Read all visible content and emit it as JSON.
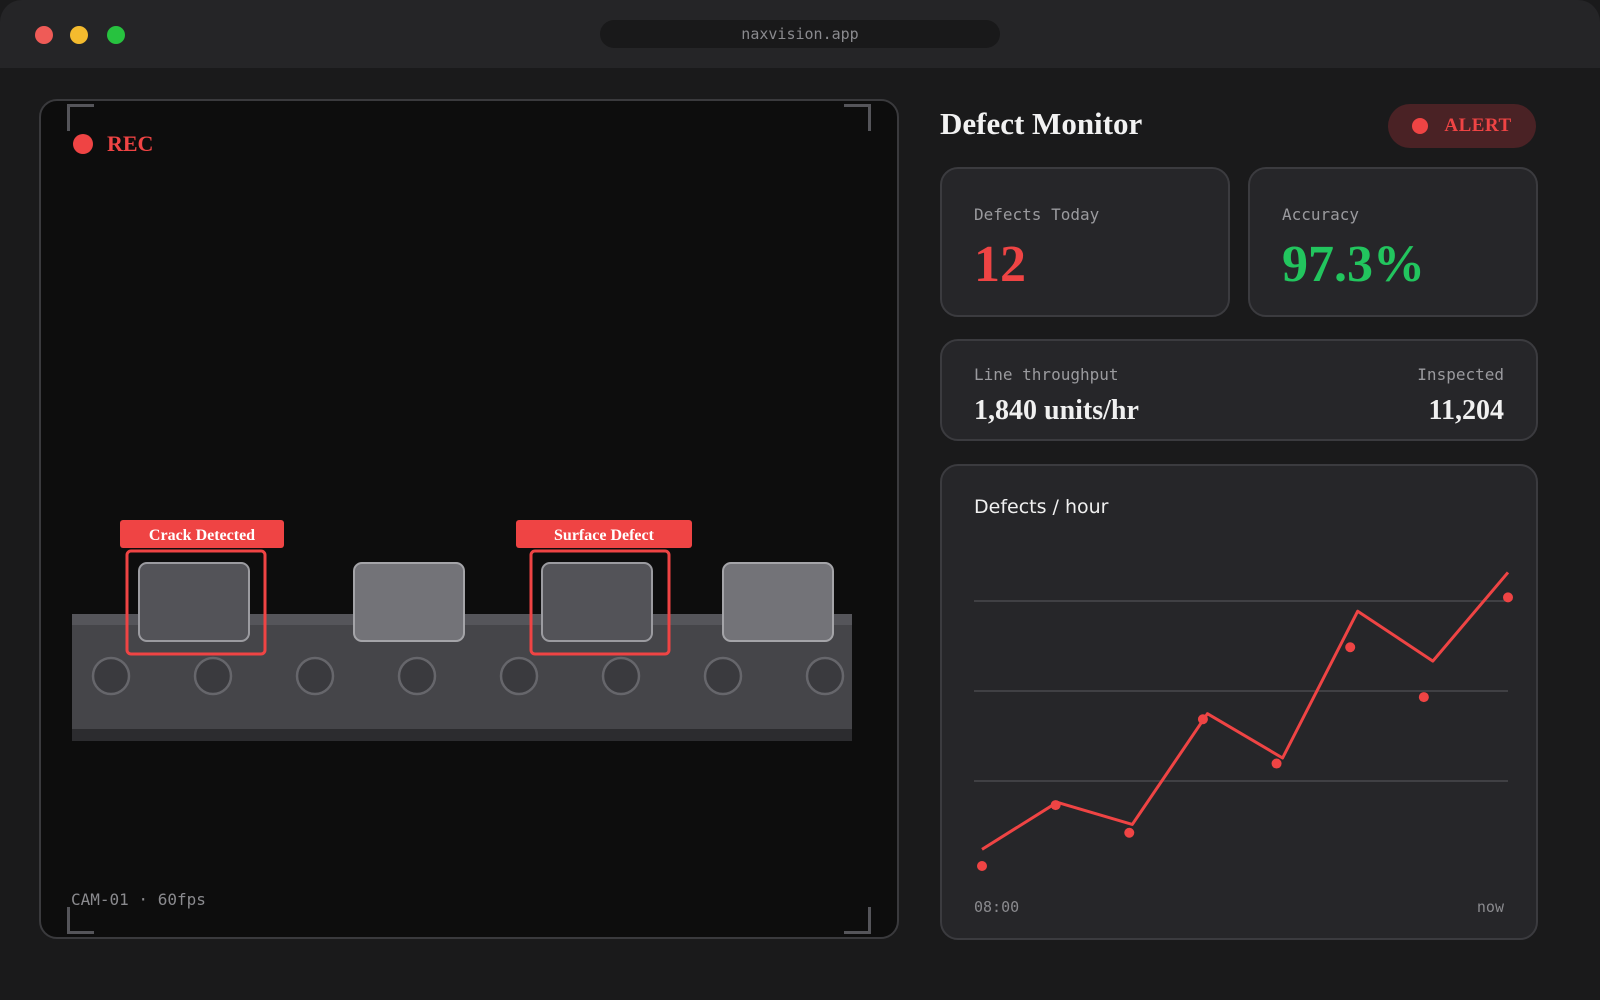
{
  "browser": {
    "url": "naxvision.app"
  },
  "camera": {
    "rec_label": "REC",
    "meta": "CAM-01 · 60fps",
    "detections": [
      {
        "label": "Crack Detected"
      },
      {
        "label": "Surface Defect"
      }
    ]
  },
  "panel": {
    "title": "Defect Monitor",
    "alert_label": "ALERT",
    "stats": {
      "defects_today": {
        "label": "Defects Today",
        "value": "12"
      },
      "accuracy": {
        "label": "Accuracy",
        "value": "97.3%"
      }
    },
    "throughput": {
      "label": "Line throughput",
      "value": "1,840 units/hr",
      "inspected_label": "Inspected",
      "inspected_value": "11,204"
    }
  },
  "colors": {
    "alert": "#ef4444",
    "success": "#22c55e",
    "background": "#1a1a1b",
    "card": "#262629"
  },
  "icons": [
    "rec-indicator-icon",
    "alert-indicator-icon"
  ],
  "chart_data": {
    "type": "line",
    "title": "Defects / hour",
    "x_labels": [
      "08:00",
      "now"
    ],
    "series": [
      {
        "values": [
          1.2,
          4.6,
          3.0,
          11.0,
          7.8,
          18.4,
          14.8,
          21.2
        ]
      }
    ],
    "scatter_points": [
      {
        "x": 0.0,
        "y": 0.0
      },
      {
        "x": 1.4,
        "y": 4.4
      },
      {
        "x": 2.8,
        "y": 2.4
      },
      {
        "x": 4.2,
        "y": 10.6
      },
      {
        "x": 5.6,
        "y": 7.4
      },
      {
        "x": 7.0,
        "y": 15.8
      },
      {
        "x": 8.4,
        "y": 12.2
      },
      {
        "x": 10.0,
        "y": 19.4
      }
    ],
    "ylim": [
      0,
      26
    ],
    "grid": true
  }
}
